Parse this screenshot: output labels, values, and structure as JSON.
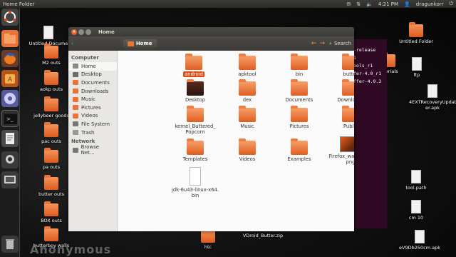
{
  "panel": {
    "title": "Home Folder",
    "time": "4:21 PM",
    "user": "dragunkorr"
  },
  "window": {
    "title": "Home",
    "breadcrumb": "Home",
    "search_label": "Search"
  },
  "sidebar": {
    "sections": [
      {
        "heading": "Computer",
        "items": [
          "Home",
          "Desktop",
          "Documents",
          "Downloads",
          "Music",
          "Pictures",
          "Videos",
          "File System",
          "Trash"
        ]
      },
      {
        "heading": "Network",
        "items": [
          "Browse Net..."
        ]
      }
    ]
  },
  "files": [
    {
      "name": "android",
      "type": "folder",
      "selected": true
    },
    {
      "name": "apktool",
      "type": "folder"
    },
    {
      "name": "bin",
      "type": "folder"
    },
    {
      "name": "butter",
      "type": "folder"
    },
    {
      "name": "Desktop",
      "type": "folder"
    },
    {
      "name": "dex",
      "type": "folder"
    },
    {
      "name": "Documents",
      "type": "folder"
    },
    {
      "name": "Downloads",
      "type": "folder"
    },
    {
      "name": "kernel_Buttered_ Popcorn",
      "type": "folder"
    },
    {
      "name": "Music",
      "type": "folder"
    },
    {
      "name": "Pictures",
      "type": "folder"
    },
    {
      "name": "Public",
      "type": "folder"
    },
    {
      "name": "Templates",
      "type": "folder"
    },
    {
      "name": "Videos",
      "type": "folder"
    },
    {
      "name": "Examples",
      "type": "folder"
    },
    {
      "name": "Firefox_wallpaper. png",
      "type": "image"
    },
    {
      "name": "jdk-6u43-linux-x64. bin",
      "type": "document"
    }
  ],
  "desktop_icons": [
    "Untitled Docume 1",
    "M2 outs",
    "aokp outs",
    "jellybeer goods",
    "pac outs",
    "pa outs",
    "butter outs",
    "BOX outs",
    "butterboy walls",
    "htc",
    "VDroid_Butter.zip",
    "Untitled Folder",
    "tutorials",
    "ftp",
    "4EXTRecoveryUpdat er.apk",
    "tool.path",
    "cm 10",
    "eV9Db250cm.apk"
  ],
  "terminal_lines": [
    "-release",
    "1",
    "ools_r1",
    "fer-4.0_r1",
    "ffer-4.0.3"
  ],
  "watermark": "Anonymous",
  "colors": {
    "accent": "#dd4814",
    "folder": "#e8743a",
    "panel": "#3c3b37"
  }
}
